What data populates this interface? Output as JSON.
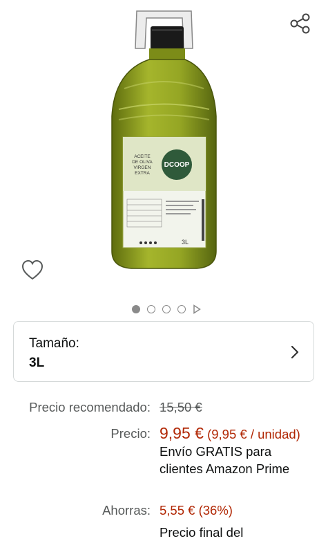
{
  "icons": {
    "share": "share-icon",
    "wishlist": "heart-icon",
    "chevron": "chevron-right-icon",
    "play": "play-icon"
  },
  "carousel": {
    "total_dots": 4,
    "active_index": 0
  },
  "product_image": {
    "label_text": "ACEITE DE OLIVA VIRGEN EXTRA",
    "brand": "DCOOP",
    "volume": "3L"
  },
  "size_selector": {
    "label": "Tamaño:",
    "value": "3L"
  },
  "pricing": {
    "recommended_label": "Precio recomendado:",
    "recommended_value": "15,50 €",
    "price_label": "Precio:",
    "price_value": "9,95 €",
    "unit_price": "(9,95 € / unidad)",
    "shipping": "Envío GRATIS para clientes Amazon Prime",
    "savings_label": "Ahorras:",
    "savings_value": "5,55 € (36%)",
    "final_price_text": "Precio final del"
  },
  "colors": {
    "price_red": "#b12704",
    "label_gray": "#565959",
    "bottle_green": "#8a9a1c",
    "cap_black": "#1a1a1a"
  }
}
